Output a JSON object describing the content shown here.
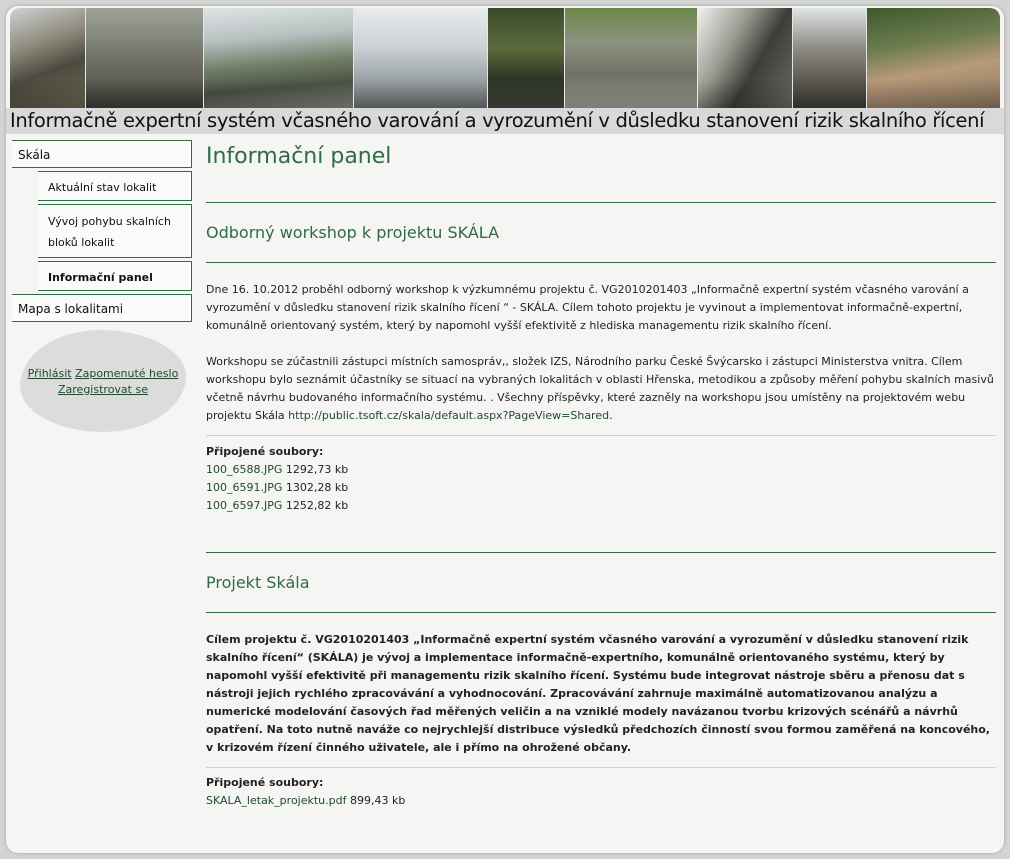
{
  "site": {
    "title": "Informačně expertní systém včasného varování a vyrozumění v důsledku stanovení rizik skalního řícení",
    "accent_color": "#2f6b44"
  },
  "sidebar": {
    "items": [
      {
        "label": "Skála"
      },
      {
        "label": "Aktuální stav lokalit"
      },
      {
        "label": "Vývoj pohybu skalních bloků lokalit"
      },
      {
        "label": "Informační panel",
        "active": true
      },
      {
        "label": "Mapa s lokalitami"
      }
    ],
    "login": {
      "label": "Přihlásit"
    },
    "forgot": {
      "label": "Zapomenuté heslo"
    },
    "register": {
      "label": "Zaregistrovat se"
    }
  },
  "main": {
    "page_title": "Informační panel",
    "attachments_label": "Připojené soubory:",
    "articles": [
      {
        "title": "Odborný workshop k projektu SKÁLA",
        "p1": "Dne 16. 10.2012 proběhl odborný workshop k výzkumnému projektu č. VG2010201403 „Informačně expertní systém včasného varování a vyrozumění v důsledku stanovení rizik skalního řícení “ - SKÁLA.  Cílem tohoto projektu je vyvinout a implementovat informačně-expertní, komunálně orientovaný systém, který by napomohl vyšší efektivitě  z hlediska  managementu rizik skalního řícení.",
        "p2": " Workshopu se zúčastnili zástupci místních samospráv,, složek IZS, Národního parku České Švýcarsko i zástupci Ministerstva vnitra. Cílem workshopu bylo seznámit účastníky se situací na vybraných lokalitách v oblasti Hřenska, metodikou a způsoby měření pohybu skalních masivů včetně návrhu budovaného informačního systému. . Všechny příspěvky, které zazněly na workshopu jsou umístěny na projektovém webu projektu Skála ",
        "link": "http://public.tsoft.cz/skala/default.aspx?PageView=Shared",
        "p2_end": ".",
        "files": [
          {
            "name": "100_6588.JPG",
            "size": "1292,73 kb"
          },
          {
            "name": "100_6591.JPG",
            "size": "1302,28 kb"
          },
          {
            "name": "100_6597.JPG",
            "size": "1252,82 kb"
          }
        ]
      },
      {
        "title": "Projekt Skála",
        "p1": "Cílem projektu č. VG2010201403 „Informačně expertní systém včasného varování a vyrozumění v důsledku stanovení rizik skalního řícení“ (SKÁLA) je vývoj a implementace informačně-expertního, komunálně orientovaného systému, který by napomohl vyšší efektivitě při managementu rizik skalního řícení. Systému bude integrovat nástroje sběru a přenosu dat s nástroji jejich rychlého zpracovávání a vyhodnocování. Zpracovávání zahrnuje maximálně automatizovanou analýzu a numerické modelování časových řad měřených veličin a na vzniklé modely navázanou tvorbu krizových scénářů a návrhů opatření. Na toto nutně naváže co nejrychlejší distribuce výsledků předchozích činností svou formou zaměřená na koncového, v krizovém řízení činného uživatele, ale i přímo na ohrožené občany.",
        "files": [
          {
            "name": "SKALA_letak_projektu.pdf",
            "size": "899,43 kb"
          }
        ]
      }
    ]
  }
}
